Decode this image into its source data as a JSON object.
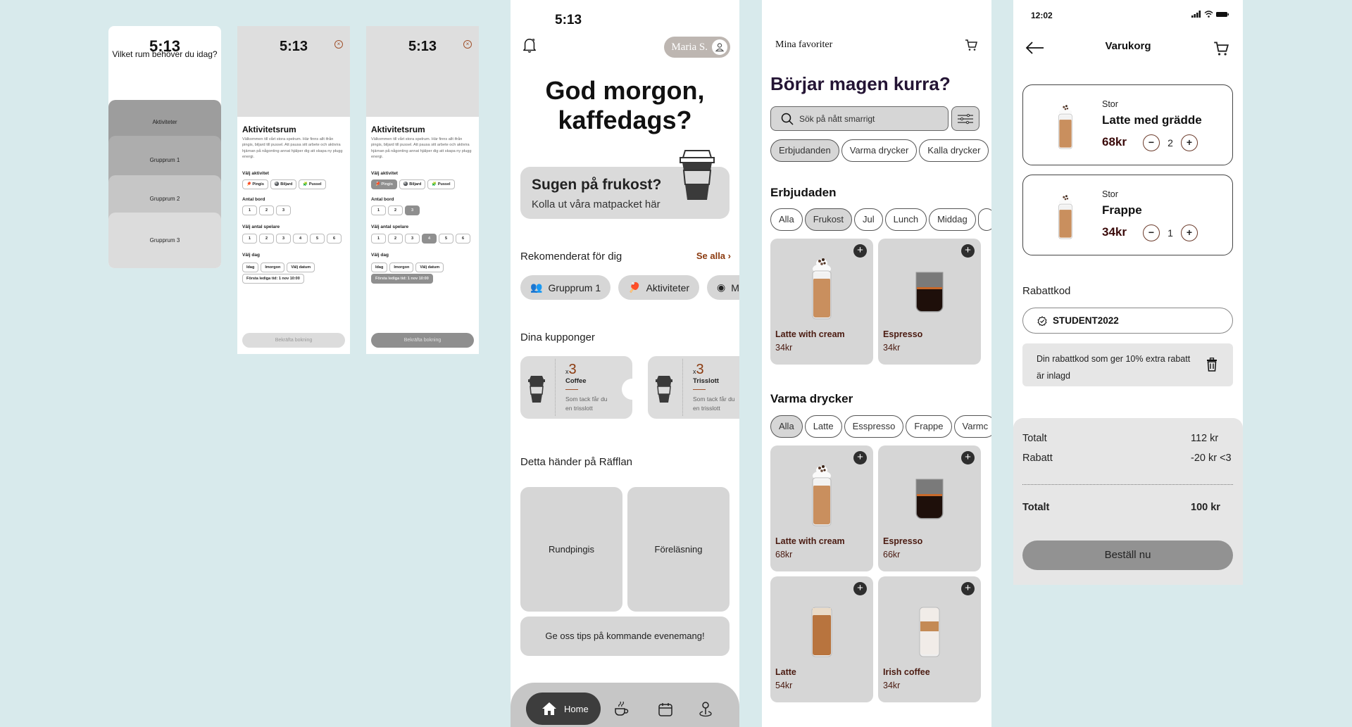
{
  "phone1": {
    "time": "5:13",
    "question": "Vilket rum behöver du idag?",
    "rooms": [
      "Aktiviteter",
      "Grupprum 1",
      "Grupprum 2",
      "Grupprum 3"
    ]
  },
  "booking_screens": [
    {
      "time": "5:13",
      "title": "Aktivitetsrum",
      "description": "Välkommen till vårt stora spelrum. Här finns allt ifrån pingis, biljard till pussel. Att pausa sitt arbete och aktivira hjärnan på någonting annat hjälper dig att skapa ny plugg energi.",
      "activity_label": "Välj aktivitet",
      "activities": [
        {
          "icon": "ping-pong-icon",
          "label": "Pingis"
        },
        {
          "icon": "billiard-icon",
          "label": "Biljard"
        },
        {
          "icon": "puzzle-icon",
          "label": "Pussel"
        }
      ],
      "selected_activity": null,
      "tables_label": "Antal bord",
      "tables": [
        "1",
        "2",
        "3"
      ],
      "selected_table": null,
      "players_label": "Välj antal spelare",
      "players": [
        "1",
        "2",
        "3",
        "4",
        "5",
        "6"
      ],
      "selected_players": null,
      "day_label": "Välj dag",
      "days": [
        "Idag",
        "Imorgon",
        "Välj datum"
      ],
      "first_available": "Första lediga tid: 1 nov 10:00",
      "first_available_selected": false,
      "confirm": "Bekräfta bokning",
      "confirm_enabled": false
    },
    {
      "time": "5:13",
      "title": "Aktivitetsrum",
      "description": "Välkommen till vårt stora spelrum. Här finns allt ifrån pingis, biljard till pussel. Att pausa sitt arbete och aktivira hjärnan på någonting annat hjälper dig att skapa ny plugg energi.",
      "activity_label": "Välj aktivitet",
      "activities": [
        {
          "icon": "ping-pong-icon",
          "label": "Pingis"
        },
        {
          "icon": "billiard-icon",
          "label": "Biljard"
        },
        {
          "icon": "puzzle-icon",
          "label": "Pussel"
        }
      ],
      "selected_activity": "Pingis",
      "tables_label": "Antal bord",
      "tables": [
        "1",
        "2",
        "3"
      ],
      "selected_table": "3",
      "players_label": "Välj antal spelare",
      "players": [
        "1",
        "2",
        "3",
        "4",
        "5",
        "6"
      ],
      "selected_players": "4",
      "day_label": "Välj dag",
      "days": [
        "Idag",
        "Imorgon",
        "Välj datum"
      ],
      "first_available": "Första lediga tid: 1 nov 10:00",
      "first_available_selected": true,
      "confirm": "Bekräfta bokning",
      "confirm_enabled": true
    }
  ],
  "home": {
    "time": "5:13",
    "user_name": "Maria S.",
    "greeting_line1": "God morgon,",
    "greeting_line2": "kaffedags?",
    "breakfast_title": "Sugen på frukost?",
    "breakfast_sub": "Kolla ut våra matpacket här",
    "recommended_title": "Rekomenderat för dig",
    "see_all": "Se alla",
    "recommended": [
      {
        "icon": "group-icon",
        "label": "Grupprum 1"
      },
      {
        "icon": "ping-pong-icon",
        "label": "Aktiviteter"
      },
      {
        "icon": "meeting-icon",
        "label": "Möte"
      }
    ],
    "coupons_title": "Dina kupponger",
    "coupons": [
      {
        "count_prefix": "x",
        "count": "3",
        "name": "Coffee",
        "desc1": "Som tack får du",
        "desc2": "en trisslott"
      },
      {
        "count_prefix": "x",
        "count": "3",
        "name": "Trisslott",
        "desc1": "Som tack får du",
        "desc2": "en trisslott"
      }
    ],
    "events_title": "Detta händer på Räfflan",
    "events": [
      "Rundpingis",
      "Föreläsning"
    ],
    "tips": "Ge oss tips på kommande evenemang!",
    "nav": {
      "home": "Home",
      "active": "home"
    }
  },
  "menu": {
    "favorites": "Mina favoriter",
    "heading": "Börjar magen kurra?",
    "search_placeholder": "Sök på nått smarrigt",
    "categories": [
      "Erbjudanden",
      "Varma drycker",
      "Kalla drycker"
    ],
    "selected_category": "Erbjudanden",
    "offers_title": "Erbjudaden",
    "offer_filters": [
      "Alla",
      "Frukost",
      "Jul",
      "Lunch",
      "Middag"
    ],
    "selected_offer_filter": "Frukost",
    "offers": [
      {
        "name": "Latte with cream",
        "price": "34kr",
        "img": "latte-cream"
      },
      {
        "name": "Espresso",
        "price": "34kr",
        "img": "espresso"
      }
    ],
    "hot_title": "Varma drycker",
    "hot_filters": [
      "Alla",
      "Latte",
      "Esspresso",
      "Frappe",
      "Varmc"
    ],
    "selected_hot_filter": "Alla",
    "hot_drinks": [
      {
        "name": "Latte with cream",
        "price": "68kr",
        "img": "latte-cream"
      },
      {
        "name": "Espresso",
        "price": "66kr",
        "img": "espresso"
      },
      {
        "name": "Latte",
        "price": "54kr",
        "img": "latte"
      },
      {
        "name": "Irish coffee",
        "price": "34kr",
        "img": "irish"
      }
    ]
  },
  "cart": {
    "time": "12:02",
    "title": "Varukorg",
    "items": [
      {
        "size": "Stor",
        "name": "Latte med grädde",
        "price": "68kr",
        "qty": "2"
      },
      {
        "size": "Stor",
        "name": "Frappe",
        "price": "34kr",
        "qty": "1"
      }
    ],
    "discount_label": "Rabattkod",
    "discount_code": "STUDENT2022",
    "discount_note": "Din rabattkod som ger 10% extra rabatt är inlagd",
    "subtotal_label": "Totalt",
    "subtotal": "112 kr",
    "discount_row_label": "Rabatt",
    "discount_value": "-20 kr <3",
    "total_label": "Totalt",
    "total": "100 kr",
    "order_button": "Beställ nu"
  },
  "colors": {
    "background": "#d8eaec",
    "accent_brown": "#8b3a0f",
    "heading_purple": "#241434",
    "card_gray": "#d6d6d6",
    "nav_dark": "#3d3d3d"
  }
}
